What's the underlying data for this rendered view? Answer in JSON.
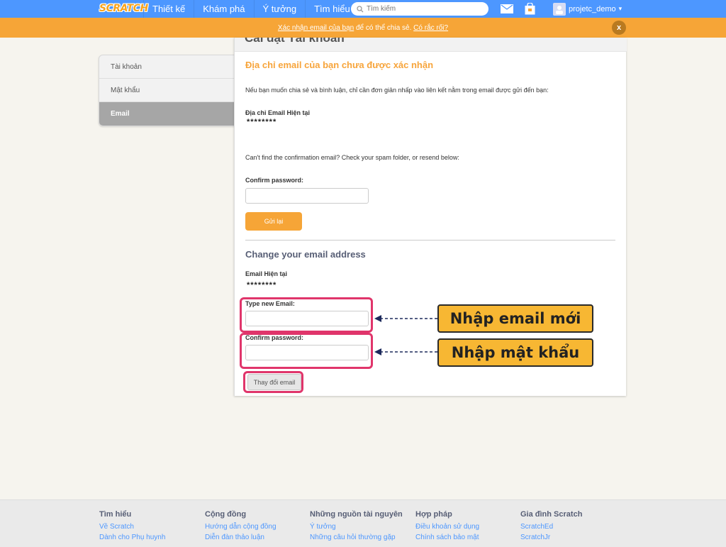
{
  "nav": {
    "logo": "SCRATCH",
    "links": [
      "Thiết kế",
      "Khám phá",
      "Ý tưởng",
      "Tìm hiểu"
    ],
    "search_placeholder": "Tìm kiếm",
    "username": "projetc_demo",
    "dropdown_glyph": "▾"
  },
  "banner": {
    "link1": "Xác nhận email của bạn",
    "middle": " để có thể chia sẻ. ",
    "link2": "Có rắc rối?",
    "close": "x"
  },
  "sidebar": {
    "items": [
      {
        "label": "Tài khoản"
      },
      {
        "label": "Mật khẩu"
      },
      {
        "label": "Email"
      }
    ]
  },
  "panel": {
    "heading": "Cài đặt Tài khoản",
    "warning_title": "Địa chỉ email của bạn chưa được xác nhận",
    "info_text": "Nếu bạn muốn chia sẻ và bình luận, chỉ cần đơn giản nhấp vào liên kết nằm trong email được gửi đến bạn:",
    "current_email_label": "Địa chỉ Email Hiện tại",
    "current_email_value": "********",
    "resend_text": "Can't find the confirmation email? Check your spam folder, or resend below:",
    "confirm_password_label": "Confirm password:",
    "resend_button": "Gửi lại",
    "change_title": "Change your email address",
    "email_now_label": "Email Hiện tại",
    "email_now_value": "********",
    "new_email_label": "Type new Email:",
    "confirm_password_label2": "Confirm password:",
    "change_button": "Thay đổi email"
  },
  "annotations": {
    "callout_email": "Nhập email mới",
    "callout_password": "Nhập mật khẩu",
    "highlight_color": "#e0356b",
    "callout_color": "#f7b733"
  },
  "footer": {
    "columns": [
      {
        "heading": "Tìm hiểu",
        "links": [
          "Về Scratch",
          "Dành cho Phụ huynh"
        ]
      },
      {
        "heading": "Cộng đồng",
        "links": [
          "Hướng dẫn cộng đồng",
          "Diễn đàn thảo luận"
        ]
      },
      {
        "heading": "Những nguồn tài nguyên",
        "links": [
          "Ý tưởng",
          "Những câu hỏi thường gặp"
        ]
      },
      {
        "heading": "Hợp pháp",
        "links": [
          "Điều khoản sử dụng",
          "Chính sách bảo mật"
        ]
      },
      {
        "heading": "Gia đình Scratch",
        "links": [
          "ScratchEd",
          "ScratchJr"
        ]
      }
    ]
  },
  "colors": {
    "nav_blue": "#4d97ff",
    "banner_orange": "#f6a537",
    "warning_orange": "#f7a43a"
  }
}
